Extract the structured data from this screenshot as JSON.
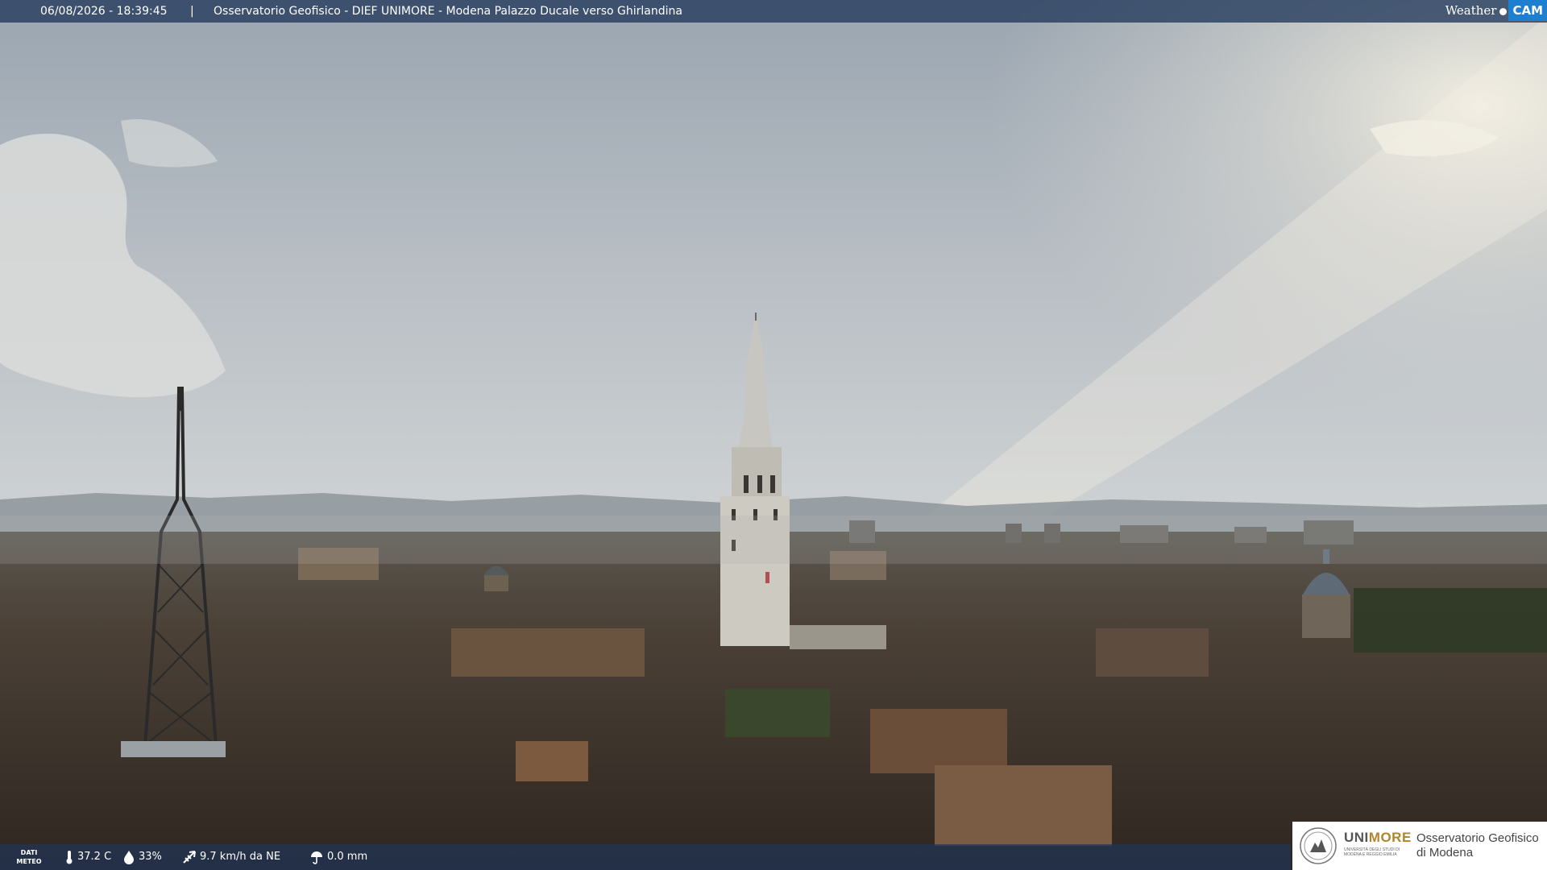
{
  "header": {
    "datetime": "06/08/2026 - 18:39:45",
    "separator": "|",
    "title": "Osservatorio Geofisico - DIEF UNIMORE - Modena Palazzo Ducale verso Ghirlandina"
  },
  "brand": {
    "weather": "Weather",
    "cam": "CAM",
    "cam_color": "#1e7fd0"
  },
  "meteo": {
    "label_line1": "DATI",
    "label_line2": "METEO",
    "temperature": "37.2 C",
    "humidity": "33%",
    "wind": "9.7 km/h da NE",
    "rain": "0.0 mm"
  },
  "logo": {
    "uni": "UNI",
    "more": "MORE",
    "university_line": "UNIVERSITÀ DEGLI STUDI DI MODENA E REGGIO EMILIA",
    "observatory_line1": "Osservatorio Geofisico",
    "observatory_line2": "di Modena"
  },
  "colors": {
    "bar": "#283e5f",
    "unimore_gold": "#b1852a"
  }
}
